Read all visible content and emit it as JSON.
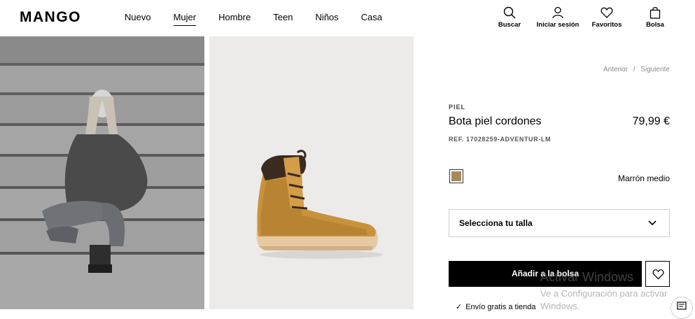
{
  "header": {
    "logo": "MANGO",
    "nav": [
      {
        "label": "Nuevo"
      },
      {
        "label": "Mujer",
        "active": true
      },
      {
        "label": "Hombre"
      },
      {
        "label": "Teen"
      },
      {
        "label": "Niños"
      },
      {
        "label": "Casa"
      }
    ],
    "actions": {
      "search": {
        "label": "Buscar",
        "icon": "search-icon"
      },
      "login": {
        "label": "Iniciar sesión",
        "icon": "user-icon"
      },
      "favorites": {
        "label": "Favoritos",
        "icon": "heart-icon"
      },
      "bag": {
        "label": "Bolsa",
        "icon": "bag-icon"
      }
    }
  },
  "gallery": {
    "model_photo": "model-photo",
    "product_photo": "boot-product-photo"
  },
  "product": {
    "pager": {
      "previous": "Anterior",
      "separator": "/",
      "next": "Siguiente"
    },
    "category": "PIEL",
    "name": "Bota piel cordones",
    "price": "79,99 €",
    "reference": "REF. 17028259-ADVENTUR-LM",
    "color": {
      "name": "Marrón medio",
      "swatch": "#a68a5c"
    },
    "size_select": {
      "label": "Selecciona tu talla"
    },
    "add_button": "Añadir a la bolsa",
    "shipping": "Envío gratis a tienda"
  },
  "watermark": {
    "title": "Activar Windows",
    "subtitle_line1": "Ve a Configuración para activar",
    "subtitle_line2": "Windows."
  },
  "colors": {
    "accent": "#000000",
    "background": "#ffffff"
  }
}
